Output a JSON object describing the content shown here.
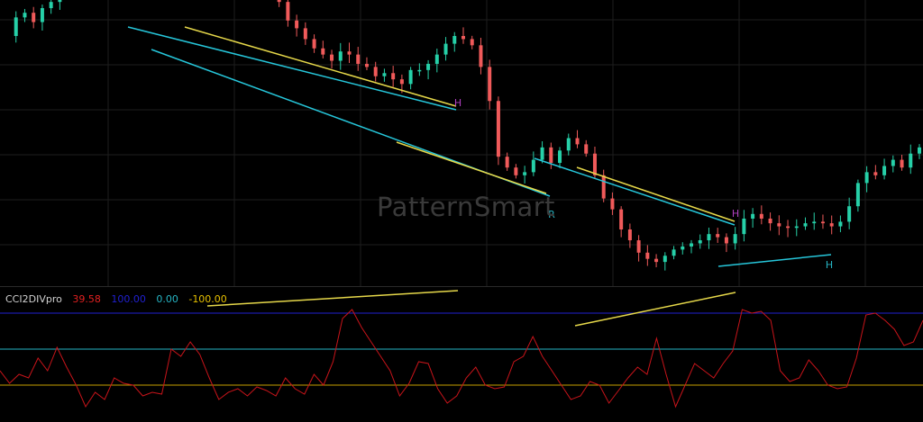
{
  "watermark": "PatternSmart",
  "indicator": {
    "name": "CCI2DIVpro",
    "values": [
      {
        "text": "39.58",
        "color": "#e02020"
      },
      {
        "text": "100.00",
        "color": "#2020d0"
      },
      {
        "text": "0.00",
        "color": "#26b5c4"
      },
      {
        "text": "-100.00",
        "color": "#e6c000"
      }
    ],
    "levels": [
      {
        "value": 100,
        "color": "#2020d0"
      },
      {
        "value": 0,
        "color": "#26b5c4"
      },
      {
        "value": -100,
        "color": "#c8a000"
      }
    ]
  },
  "pattern_labels": [
    {
      "text": "H",
      "color": "#b040c0"
    },
    {
      "text": "R",
      "color": "#26b5c4"
    },
    {
      "text": "H",
      "color": "#b040c0"
    },
    {
      "text": "H",
      "color": "#26b5c4"
    }
  ],
  "colors": {
    "up": "#26d0a8",
    "down": "#f05a5a",
    "channel": "#26c6da",
    "divergence": "#e6d84a",
    "cci": "#c8141a",
    "grid": "#1e1e1e"
  },
  "chart_data": [
    {
      "type": "candlestick",
      "title": "",
      "xlabel": "",
      "ylabel": "",
      "grid": true,
      "price_path": [
        0,
        12,
        15,
        9,
        18,
        22,
        28,
        30,
        37,
        40,
        60,
        58,
        55,
        62,
        58,
        50,
        45,
        42,
        48,
        52,
        53,
        49,
        52,
        55,
        52,
        45,
        40,
        35,
        32,
        36,
        30,
        22,
        10,
        5,
        -2,
        -8,
        -12,
        -16,
        -10,
        -12,
        -18,
        -20,
        -26,
        -24,
        -28,
        -31,
        -22,
        -22,
        -18,
        -12,
        -5,
        0,
        -2,
        -6,
        -20,
        -42,
        -78,
        -85,
        -90,
        -88,
        -80,
        -72,
        -82,
        -74,
        -66,
        -70,
        -76,
        -90,
        -105,
        -112,
        -125,
        -132,
        -140,
        -144,
        -146,
        -142,
        -138,
        -136,
        -134,
        -132,
        -128,
        -130,
        -134,
        -128,
        -118,
        -115,
        -118,
        -121,
        -123,
        -124,
        -123,
        -121,
        -120,
        -121,
        -123,
        -120,
        -110,
        -95,
        -88,
        -90,
        -84,
        -80,
        -85,
        -76,
        -72
      ]
    },
    {
      "type": "line",
      "title": "",
      "series": [
        {
          "name": "CCI2DIVpro",
          "values": [
            -60,
            -95,
            -70,
            -80,
            -25,
            -60,
            5,
            -50,
            -100,
            -160,
            -120,
            -140,
            -80,
            -95,
            -100,
            -130,
            -120,
            -125,
            0,
            -20,
            20,
            -15,
            -80,
            -140,
            -120,
            -110,
            -130,
            -105,
            -115,
            -130,
            -80,
            -110,
            -125,
            -70,
            -100,
            -35,
            85,
            110,
            60,
            20,
            -20,
            -60,
            -130,
            -95,
            -35,
            -40,
            -110,
            -150,
            -130,
            -80,
            -50,
            -100,
            -110,
            -105,
            -35,
            -20,
            35,
            -20,
            -60,
            -100,
            -140,
            -130,
            -90,
            -100,
            -150,
            -115,
            -80,
            -50,
            -70,
            30,
            -70,
            -160,
            -100,
            -40,
            -60,
            -80,
            -40,
            -5,
            110,
            100,
            105,
            80,
            -60,
            -90,
            -80,
            -30,
            -60,
            -100,
            -110,
            -105,
            -25,
            95,
            100,
            80,
            55,
            10,
            20,
            80
          ]
        }
      ],
      "ylim": [
        -200,
        120
      ]
    }
  ]
}
